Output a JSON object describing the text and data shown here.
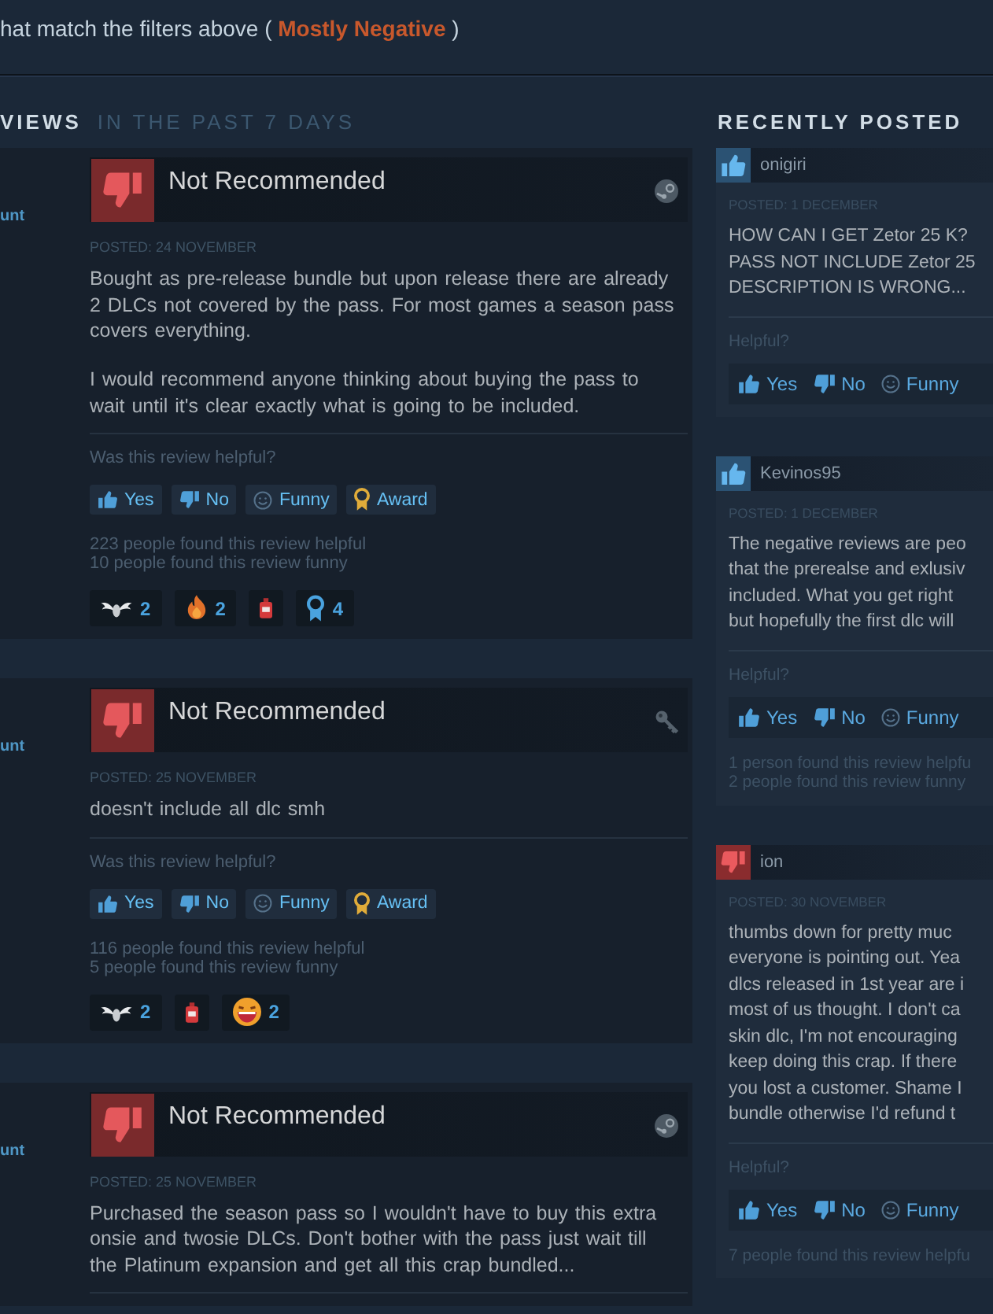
{
  "filter_summary": {
    "prefix": "hat match the filters above (",
    "rating": "Mostly Negative",
    "suffix": ")"
  },
  "reviews_section": {
    "title": "VIEWS",
    "subtitle": "IN THE PAST 7 DAYS",
    "reviews": [
      {
        "author_fragment": "unt",
        "recommended": false,
        "verdict": "Not Recommended",
        "source_icon": {
          "kind": "steam"
        },
        "posted": "POSTED: 24 NOVEMBER",
        "paragraphs": [
          "Bought as pre-release bundle but upon release there are already 2 DLCs not covered by the pass. For most games a season pass covers everything.",
          "I would recommend anyone thinking about buying the pass to wait until it's clear exactly what is going to be included."
        ],
        "helpful_prompt": "Was this review helpful?",
        "vote_buttons": [
          {
            "kind": "yes",
            "label": "Yes"
          },
          {
            "kind": "no",
            "label": "No"
          },
          {
            "kind": "funny",
            "label": "Funny"
          },
          {
            "kind": "award",
            "label": "Award"
          }
        ],
        "counts": [
          "223 people found this review helpful",
          "10 people found this review funny"
        ],
        "awards": [
          {
            "kind": "wings",
            "count": "2"
          },
          {
            "kind": "flame",
            "count": "2"
          },
          {
            "kind": "bottle"
          },
          {
            "kind": "medal",
            "count": "4"
          }
        ]
      },
      {
        "author_fragment": "unt",
        "recommended": false,
        "verdict": "Not Recommended",
        "source_icon": {
          "kind": "key"
        },
        "posted": "POSTED: 25 NOVEMBER",
        "paragraphs": [
          "doesn't include all dlc smh"
        ],
        "helpful_prompt": "Was this review helpful?",
        "vote_buttons": [
          {
            "kind": "yes",
            "label": "Yes"
          },
          {
            "kind": "no",
            "label": "No"
          },
          {
            "kind": "funny",
            "label": "Funny"
          },
          {
            "kind": "award",
            "label": "Award"
          }
        ],
        "counts": [
          "116 people found this review helpful",
          "5 people found this review funny"
        ],
        "awards": [
          {
            "kind": "wings",
            "count": "2"
          },
          {
            "kind": "bottle"
          },
          {
            "kind": "laugh",
            "count": "2"
          }
        ]
      },
      {
        "author_fragment": "unt",
        "recommended": false,
        "verdict": "Not Recommended",
        "source_icon": {
          "kind": "steam"
        },
        "posted": "POSTED: 25 NOVEMBER",
        "paragraphs": [
          "Purchased the season pass so I wouldn't have to buy this extra onsie and twosie DLCs. Don't bother with the pass just wait till the Platinum expansion and get all this crap bundled..."
        ]
      }
    ]
  },
  "recently_posted": {
    "title": "RECENTLY POSTED",
    "reviews": [
      {
        "recommended": true,
        "author": "onigiri",
        "posted": "POSTED: 1 DECEMBER",
        "lines": [
          "HOW CAN I GET Zetor 25 K?",
          "PASS NOT INCLUDE Zetor 25",
          "DESCRIPTION IS WRONG..."
        ],
        "helpful_prompt": "Helpful?",
        "vote_buttons": [
          {
            "kind": "yes",
            "label": "Yes"
          },
          {
            "kind": "no",
            "label": "No"
          },
          {
            "kind": "funny",
            "label": "Funny"
          }
        ]
      },
      {
        "recommended": true,
        "author": "Kevinos95",
        "posted": "POSTED: 1 DECEMBER",
        "lines": [
          "The negative reviews are peo",
          "that the prerealse and exlusiv",
          "included. What you get right",
          "but hopefully the first dlc will"
        ],
        "helpful_prompt": "Helpful?",
        "vote_buttons": [
          {
            "kind": "yes",
            "label": "Yes"
          },
          {
            "kind": "no",
            "label": "No"
          },
          {
            "kind": "funny",
            "label": "Funny"
          }
        ],
        "counts": [
          "1 person found this review helpfu",
          "2 people found this review funny"
        ]
      },
      {
        "recommended": false,
        "author": "ion",
        "posted": "POSTED: 30 NOVEMBER",
        "lines": [
          "thumbs down for pretty muc",
          "everyone is pointing out. Yea",
          "dlcs released in 1st year are i",
          "most of us thought. I don't ca",
          "skin dlc, I'm not encouraging",
          "keep doing this crap. If there",
          "you lost a customer. Shame I",
          "bundle otherwise I'd refund t"
        ],
        "helpful_prompt": "Helpful?",
        "vote_buttons": [
          {
            "kind": "yes",
            "label": "Yes"
          },
          {
            "kind": "no",
            "label": "No"
          },
          {
            "kind": "funny",
            "label": "Funny"
          }
        ],
        "counts": [
          "7 people found this review helpfu"
        ]
      }
    ]
  }
}
